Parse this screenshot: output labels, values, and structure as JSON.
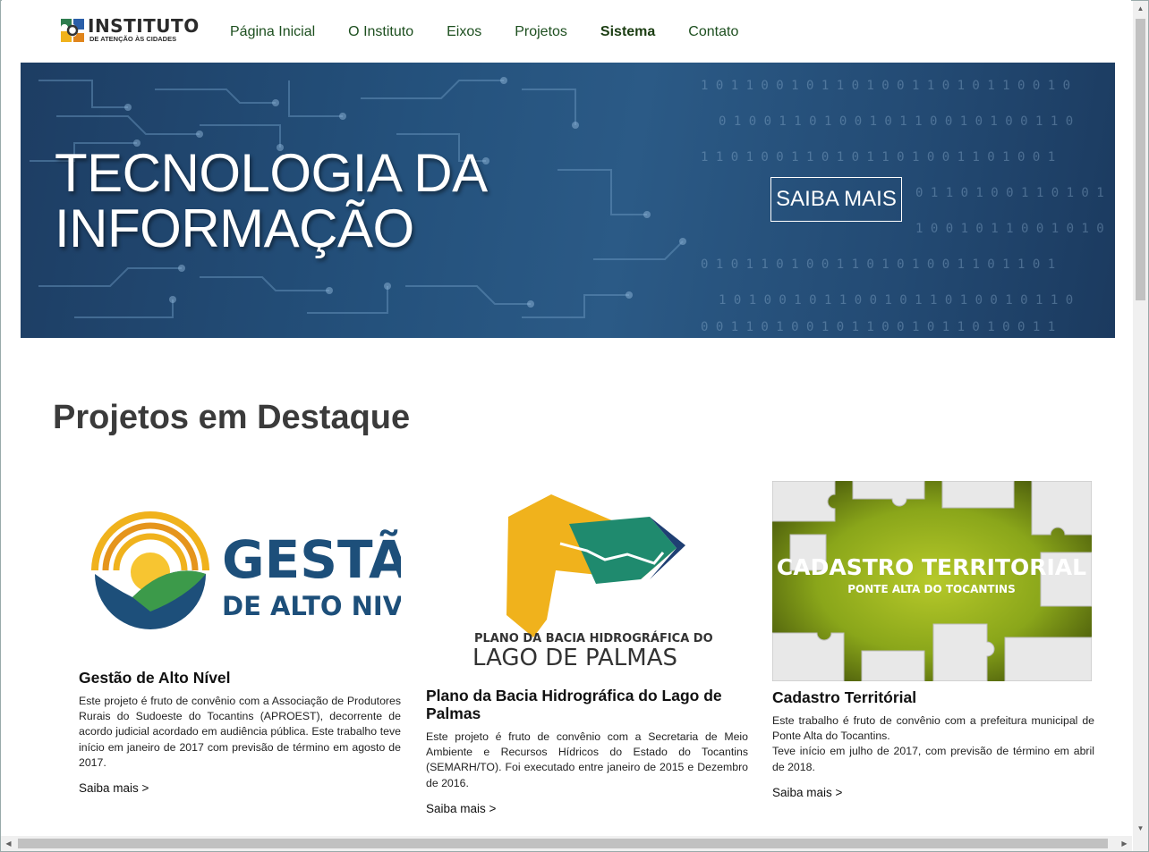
{
  "header": {
    "logo_title": "INSTITUTO",
    "logo_subtitle": "DE ATENÇÃO ÀS CIDADES",
    "nav": [
      {
        "label": "Página Inicial",
        "active": false
      },
      {
        "label": "O Instituto",
        "active": false
      },
      {
        "label": "Eixos",
        "active": false
      },
      {
        "label": "Projetos",
        "active": false
      },
      {
        "label": "Sistema",
        "active": true
      },
      {
        "label": "Contato",
        "active": false
      }
    ]
  },
  "banner": {
    "title": "TECNOLOGIA DA\nINFORMAÇÃO",
    "button": "SAIBA MAIS"
  },
  "projects": {
    "section_title": "Projetos em Destaque",
    "cards": [
      {
        "logo_line1": "GESTÃO",
        "logo_line2": "DE ALTO NIVEL",
        "title": "Gestão de Alto Nível",
        "description": "Este projeto é fruto de convênio com a Associação de Produtores Rurais do Sudoeste do Tocantins (APROEST), decorrente de acordo judicial acordado em audiência pública. Este trabalho teve início em janeiro de 2017 com previsão de término em agosto de 2017.",
        "link": "Saiba mais >"
      },
      {
        "logo_line1": "PLANO DA BACIA HIDROGRÁFICA DO",
        "logo_line2": "LAGO DE PALMAS",
        "title": "Plano da Bacia Hidrográfica do Lago de Palmas",
        "description": "Este projeto é fruto de convênio com a Secretaria de Meio Ambiente e Recursos Hídricos do Estado do Tocantins (SEMARH/TO). Foi executado entre janeiro de 2015 e Dezembro de 2016.",
        "link": "Saiba mais >"
      },
      {
        "logo_line1": "CADASTRO TERRITORIAL",
        "logo_line2": "PONTE ALTA DO TOCANTINS",
        "title": "Cadastro Territórial",
        "description": "Este trabalho é fruto de convênio com a prefeitura municipal de Ponte Alta do Tocantins.\nTeve início em julho de 2017, com previsão de término em abril de 2018.",
        "link": "Saiba mais >"
      }
    ]
  },
  "colors": {
    "nav_text": "#1d4f1f",
    "banner_blue": "#24517c",
    "gestao_blue": "#1d4f7a",
    "gestao_yellow": "#f0b21c",
    "palmas_yellow": "#f0b21c",
    "palmas_green": "#1f8a6e",
    "palmas_navy": "#1f3f73",
    "cadastro_green": "#8aa61a"
  }
}
